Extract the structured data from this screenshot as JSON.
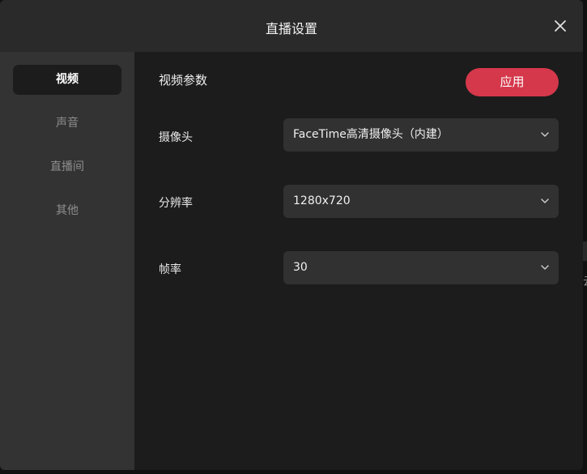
{
  "dialog": {
    "title": "直播设置"
  },
  "sidebar": {
    "items": [
      {
        "label": "视频",
        "active": true
      },
      {
        "label": "声音",
        "active": false
      },
      {
        "label": "直播间",
        "active": false
      },
      {
        "label": "其他",
        "active": false
      }
    ]
  },
  "main": {
    "section_title": "视频参数",
    "apply_label": "应用",
    "fields": [
      {
        "label": "摄像头",
        "value": "FaceTime高清摄像头（内建）"
      },
      {
        "label": "分辨率",
        "value": "1280x720"
      },
      {
        "label": "帧率",
        "value": "30"
      }
    ]
  },
  "background": {
    "edge_text": "云"
  },
  "colors": {
    "accent": "#d5384b",
    "dialog_bg": "#1c1c1c",
    "titlebar_bg": "#2a2a2a",
    "sidebar_bg": "#333333",
    "select_bg": "#313131"
  },
  "icons": {
    "close": "close-icon",
    "dropdown": "chevron-down-icon"
  }
}
